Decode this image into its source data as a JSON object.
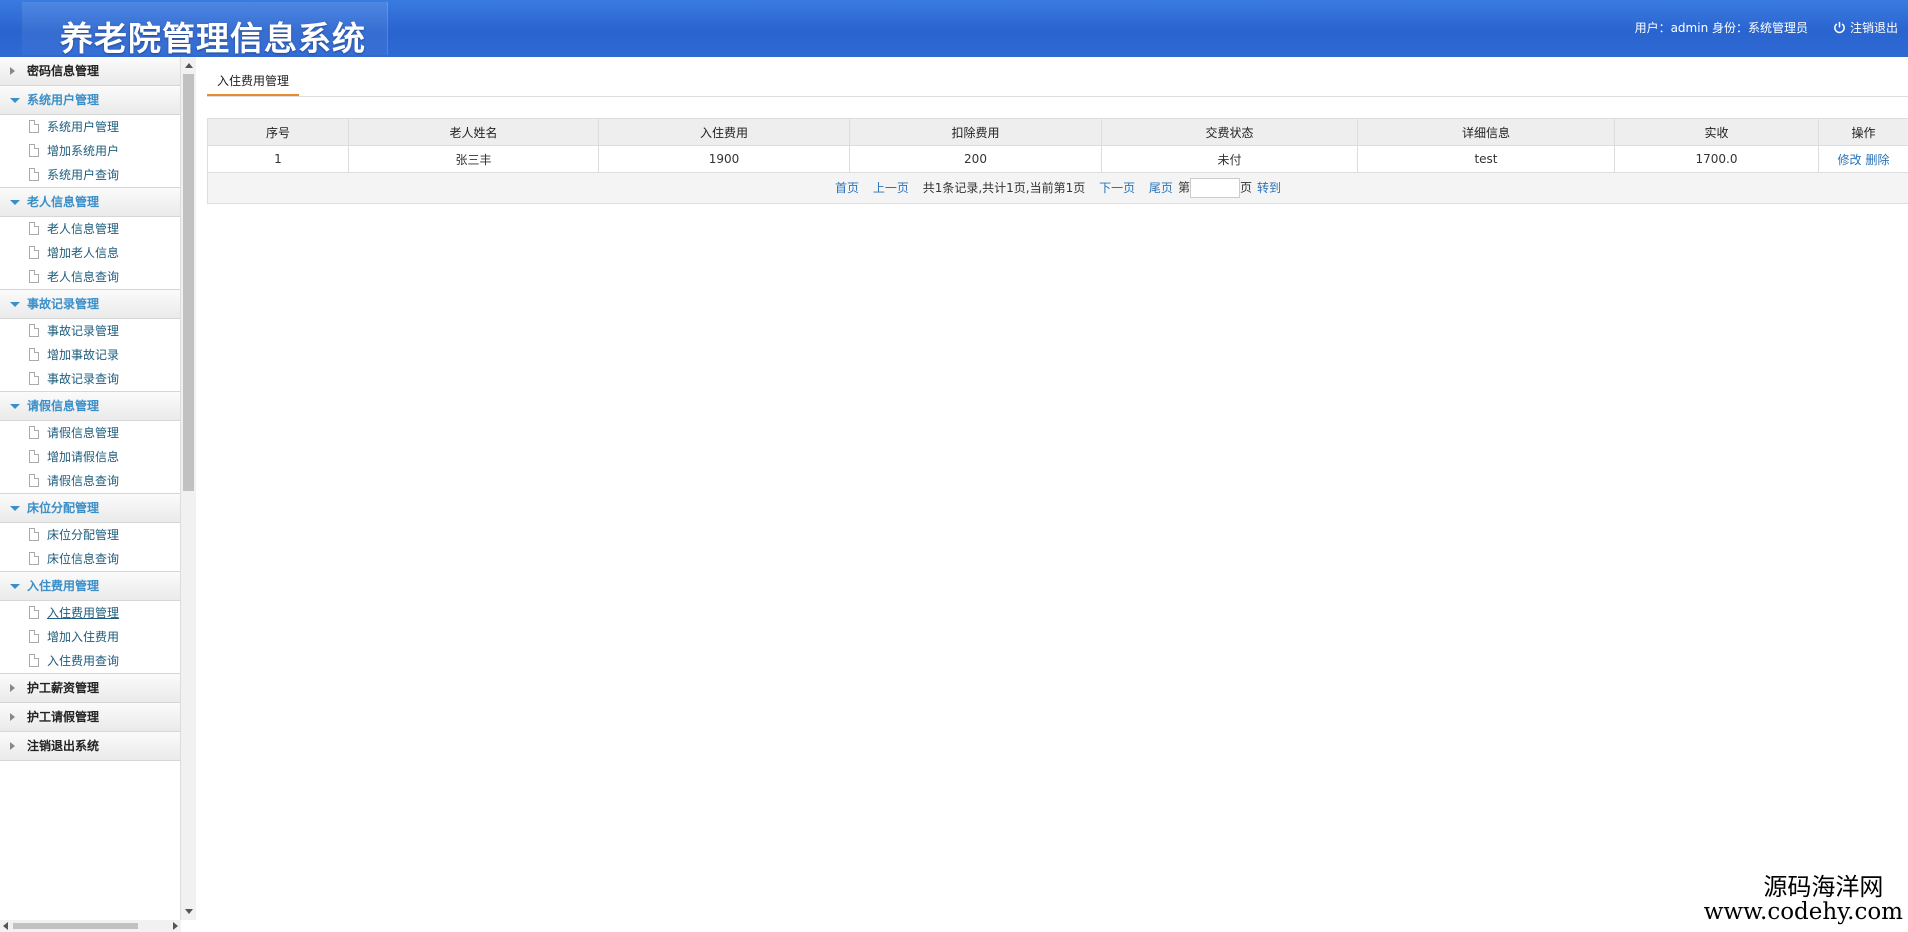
{
  "header": {
    "title": "养老院管理信息系统",
    "user_info": "用户：admin 身份：系统管理员",
    "logout_label": "注销退出"
  },
  "sidebar": {
    "groups": [
      {
        "label": "密码信息管理",
        "open": false,
        "items": []
      },
      {
        "label": "系统用户管理",
        "open": true,
        "items": [
          "系统用户管理",
          "增加系统用户",
          "系统用户查询"
        ]
      },
      {
        "label": "老人信息管理",
        "open": true,
        "items": [
          "老人信息管理",
          "增加老人信息",
          "老人信息查询"
        ]
      },
      {
        "label": "事故记录管理",
        "open": true,
        "items": [
          "事故记录管理",
          "增加事故记录",
          "事故记录查询"
        ]
      },
      {
        "label": "请假信息管理",
        "open": true,
        "items": [
          "请假信息管理",
          "增加请假信息",
          "请假信息查询"
        ]
      },
      {
        "label": "床位分配管理",
        "open": true,
        "items": [
          "床位分配管理",
          "床位信息查询"
        ]
      },
      {
        "label": "入住费用管理",
        "open": true,
        "items": [
          "入住费用管理",
          "增加入住费用",
          "入住费用查询"
        ]
      },
      {
        "label": "护工薪资管理",
        "open": false,
        "items": []
      },
      {
        "label": "护工请假管理",
        "open": false,
        "items": []
      },
      {
        "label": "注销退出系统",
        "open": false,
        "items": []
      }
    ]
  },
  "main": {
    "tab_label": "入住费用管理",
    "columns": [
      "序号",
      "老人姓名",
      "入住费用",
      "扣除费用",
      "交费状态",
      "详细信息",
      "实收",
      "操作"
    ],
    "rows": [
      {
        "no": "1",
        "name": "张三丰",
        "fee": "1900",
        "deduct": "200",
        "status": "未付",
        "detail": "test",
        "actual": "1700.0",
        "edit": "修改",
        "delete": "删除"
      }
    ],
    "pager": {
      "first": "首页",
      "prev": "上一页",
      "info": "共1条记录,共计1页,当前第1页",
      "next": "下一页",
      "last": "尾页",
      "page_prefix": "第",
      "page_input": "",
      "page_suffix": "页",
      "go": "转到"
    }
  },
  "watermark": {
    "cn": "源码海洋网",
    "url": "www.codehy.com"
  }
}
